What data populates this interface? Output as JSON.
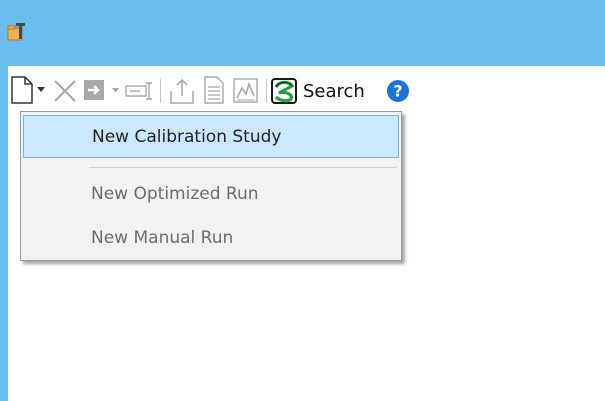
{
  "colors": {
    "title_bg": "#6abdef",
    "highlight_bg": "#cce8ff",
    "highlight_border": "#77b3e6",
    "accent_blue": "#1e73d8",
    "search_green": "#2a9d44"
  },
  "titlebar": {
    "icon": "app-icon"
  },
  "toolbar": {
    "icons": [
      "new-document-icon",
      "dropdown-arrow-icon",
      "delete-icon",
      "export-icon",
      "dropdown-arrow-icon",
      "rename-icon",
      "upload-icon",
      "document-icon",
      "chart-icon",
      "search-logo-icon",
      "help-icon"
    ],
    "search_label": "Search",
    "help_glyph": "?"
  },
  "menu": {
    "items": [
      {
        "label": "New Calibration Study",
        "state": "highlighted"
      },
      {
        "label": "New Optimized Run",
        "state": "disabled"
      },
      {
        "label": "New Manual Run",
        "state": "disabled"
      }
    ]
  }
}
